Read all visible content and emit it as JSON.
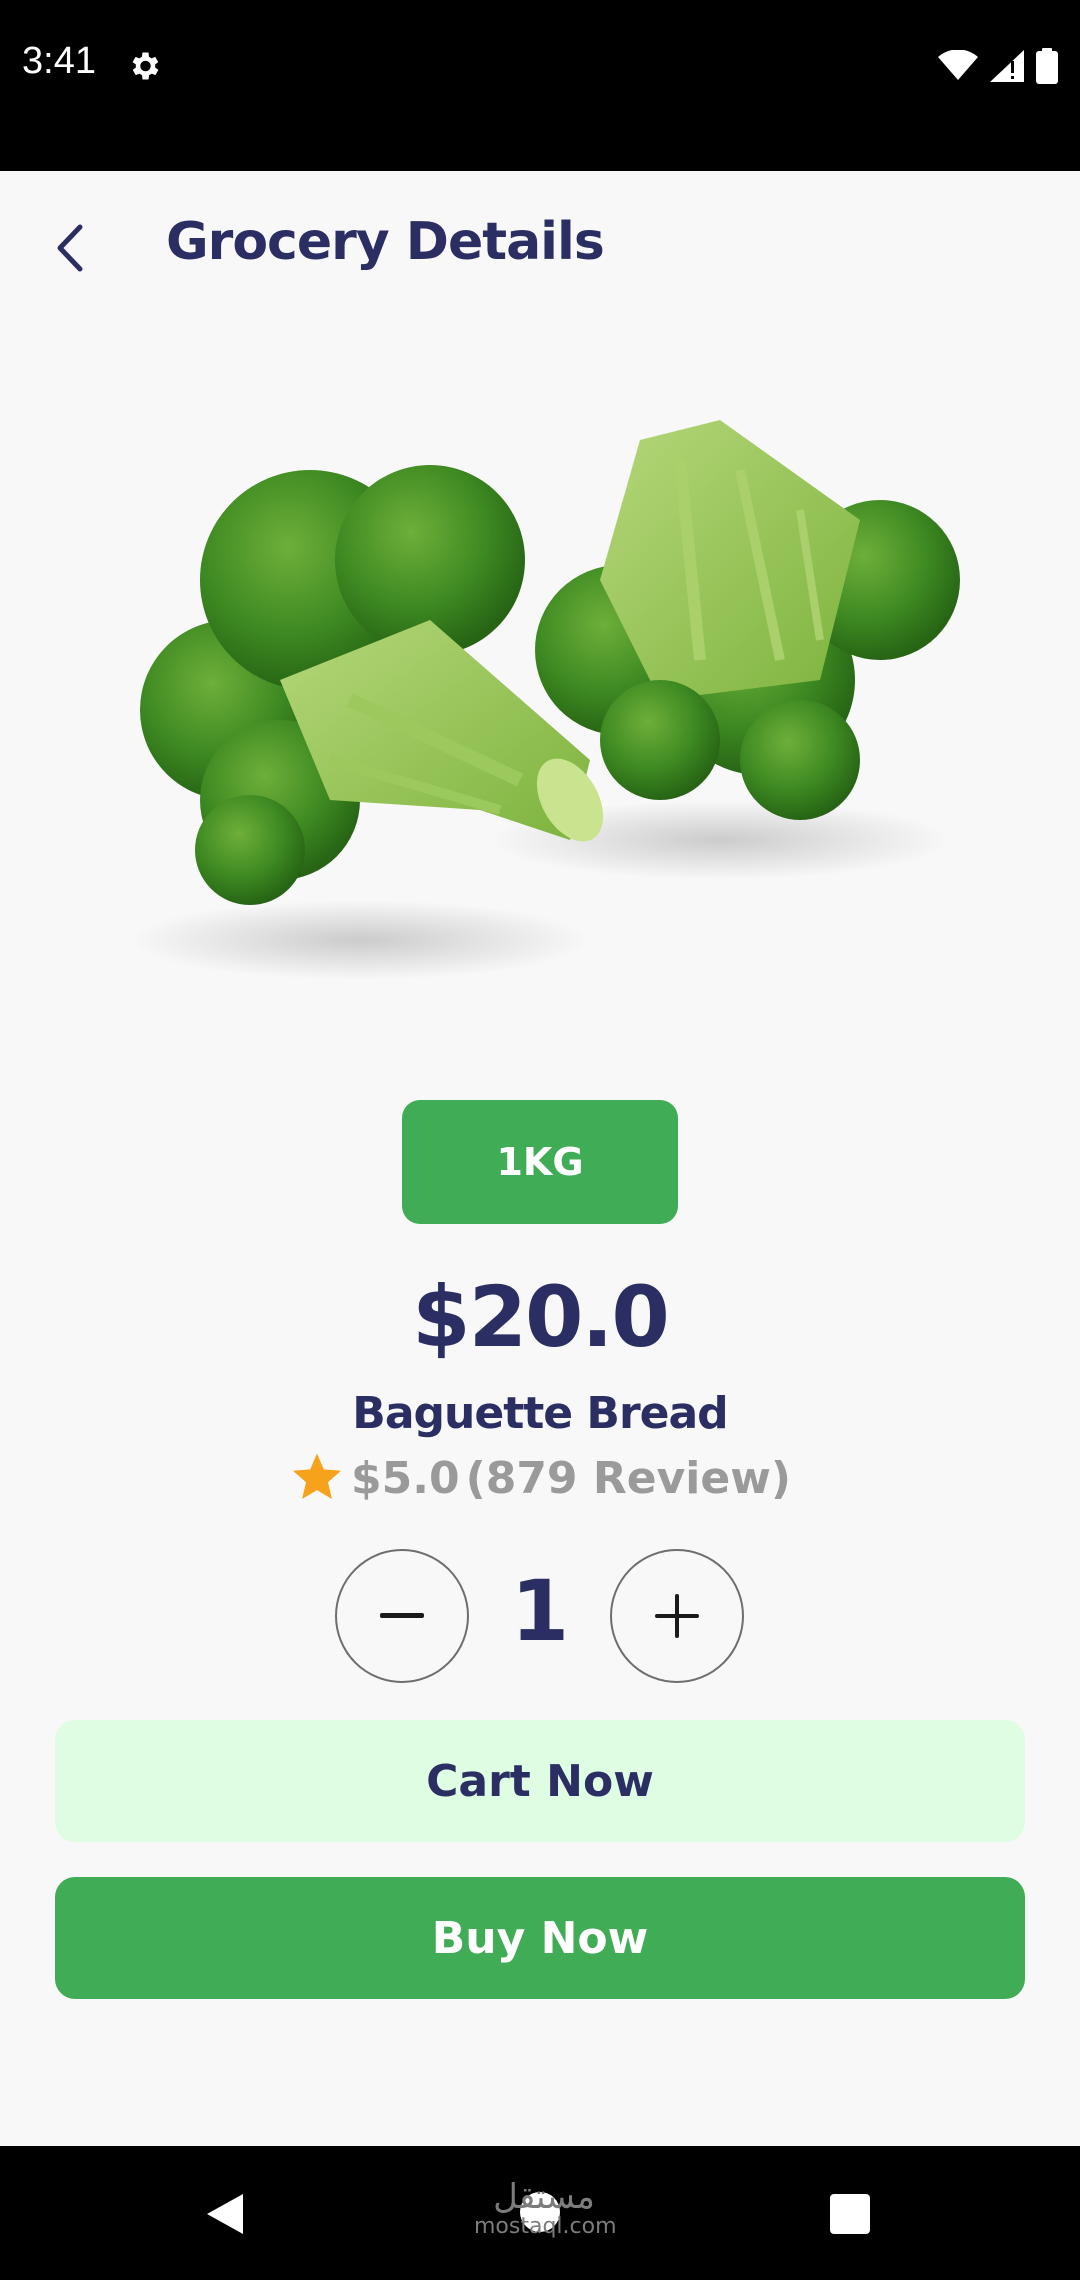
{
  "status_bar": {
    "time": "3:41",
    "icons": [
      "settings-icon",
      "wifi-icon",
      "signal-icon",
      "battery-icon"
    ]
  },
  "header": {
    "title": "Grocery Details",
    "back_icon": "chevron-left-icon"
  },
  "product": {
    "image": "broccoli-image",
    "weight_label": "1KG",
    "price": "$20.0",
    "name": "Baguette Bread",
    "rating_icon": "star-icon",
    "rating": "$5.0",
    "reviews": "(879 Review)"
  },
  "quantity": {
    "value": "1",
    "minus_icon": "minus-icon",
    "plus_icon": "plus-icon"
  },
  "actions": {
    "cart_label": "Cart Now",
    "buy_label": "Buy Now"
  },
  "navigation": {
    "watermark_arabic": "مستقل",
    "watermark_latin": "mostaql.com"
  },
  "colors": {
    "primary_green": "#40AC55",
    "light_green": "#DFFDE3",
    "navy": "#2B2E63",
    "star": "#F7A21B",
    "muted_text": "#9A9A9A",
    "background": "#F8F8F8"
  }
}
